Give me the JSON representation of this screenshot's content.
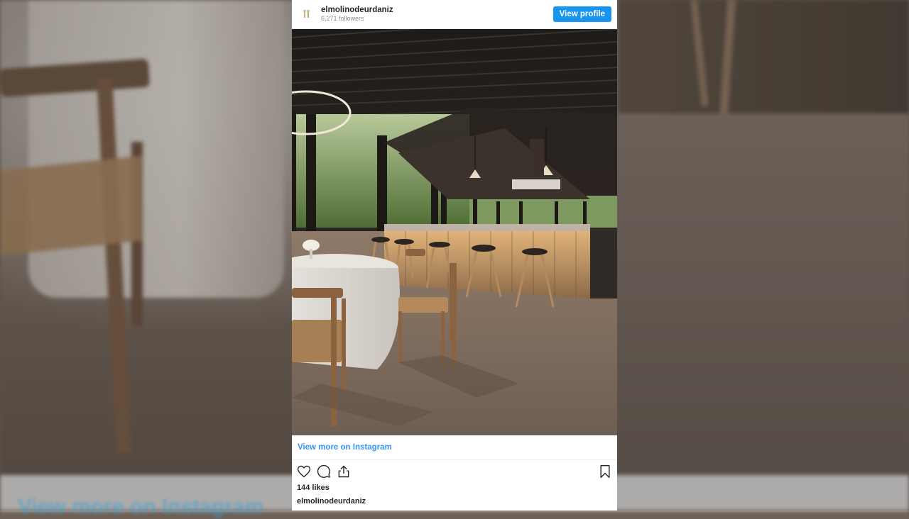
{
  "background": {
    "blurred_link_text": "View more on Instagram"
  },
  "embed": {
    "account": {
      "username": "elmolinodeurdaniz",
      "followers": "6,271 followers",
      "avatar_icon": "logo-icon"
    },
    "view_profile_label": "View profile",
    "view_more_label": "View more on Instagram",
    "likes": "144 likes",
    "caption_username": "elmolinodeurdaniz",
    "icons": {
      "like": "heart-icon",
      "comment": "comment-icon",
      "share": "share-icon",
      "save": "bookmark-icon"
    },
    "colors": {
      "accent": "#1896ef",
      "link": "#3897f0"
    }
  }
}
